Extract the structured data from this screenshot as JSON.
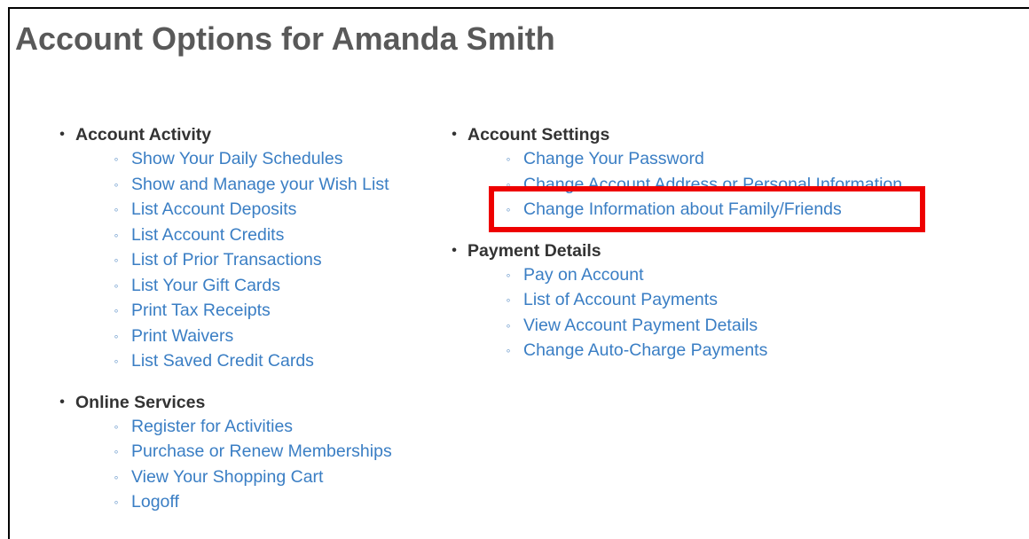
{
  "page": {
    "title": "Account Options for Amanda Smith"
  },
  "bullets": {
    "section": "•",
    "item": "◦"
  },
  "sections": {
    "account_activity": {
      "heading": "Account Activity",
      "items": [
        "Show Your Daily Schedules",
        "Show and Manage your Wish List",
        "List Account Deposits",
        "List Account Credits",
        "List of Prior Transactions",
        "List Your Gift Cards",
        "Print Tax Receipts",
        "Print Waivers",
        "List Saved Credit Cards"
      ]
    },
    "online_services": {
      "heading": "Online Services",
      "items": [
        "Register for Activities",
        "Purchase or Renew Memberships",
        "View Your Shopping Cart",
        "Logoff"
      ]
    },
    "account_settings": {
      "heading": "Account Settings",
      "items": [
        "Change Your Password",
        "Change Account Address or Personal Information",
        "Change Information about Family/Friends"
      ]
    },
    "payment_details": {
      "heading": "Payment Details",
      "items": [
        "Pay on Account",
        "List of Account Payments",
        "View Account Payment Details",
        "Change Auto-Charge Payments"
      ]
    }
  },
  "colors": {
    "title": "#595959",
    "heading": "#333333",
    "link": "#3a7ec4",
    "highlight": "#ee0000",
    "frame": "#000000"
  },
  "highlight": {
    "target": "Change Information about Family/Friends"
  }
}
